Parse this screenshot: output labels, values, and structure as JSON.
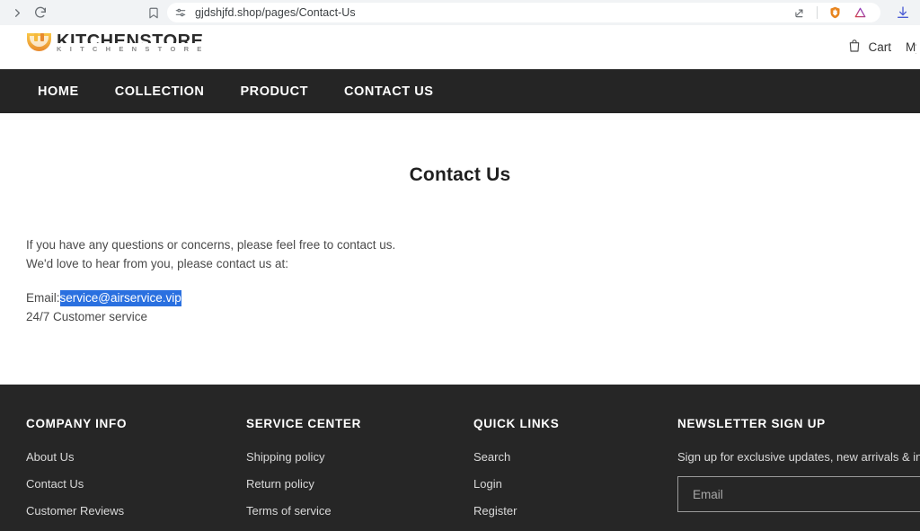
{
  "browser": {
    "url": "gjdshjfd.shop/pages/Contact-Us",
    "forward_icon": "forward-arrow-icon",
    "reload_icon": "reload-icon",
    "bookmark_icon": "bookmark-icon",
    "site_settings_icon": "site-settings-icon",
    "share_icon": "share-icon",
    "shield_icon": "brave-shield-icon",
    "extension_icon": "triangle-extension-icon",
    "download_icon": "download-icon",
    "colors": {
      "chrome_bg": "#f1f3f5",
      "shield": "#e8851f",
      "extension": "#d53f45"
    }
  },
  "header": {
    "logo_wordmark": "KITCHENSTORE",
    "logo_sub": "K I T C H E N S T O R E",
    "cart_label": "Cart",
    "cart_icon": "shopping-bag-icon",
    "account_label": "My Account"
  },
  "nav": {
    "items": [
      {
        "label": "HOME"
      },
      {
        "label": "COLLECTION"
      },
      {
        "label": "PRODUCT"
      },
      {
        "label": "CONTACT US"
      }
    ]
  },
  "main": {
    "title": "Contact Us",
    "paragraph_line1": "If you have any questions or concerns, please feel free to contact us.",
    "paragraph_line2": "We'd love to hear from you, please contact us at:",
    "email_label": "Email:",
    "email_value": "service@airservice.vip",
    "email_selected": true,
    "selection_color": "#2a70e0",
    "support_line": "24/7 Customer service"
  },
  "footer": {
    "bg_color": "#262626",
    "columns": [
      {
        "title": "COMPANY INFO",
        "links": [
          {
            "label": "About Us"
          },
          {
            "label": "Contact Us"
          },
          {
            "label": "Customer Reviews"
          }
        ]
      },
      {
        "title": "SERVICE CENTER",
        "links": [
          {
            "label": "Shipping policy"
          },
          {
            "label": "Return policy"
          },
          {
            "label": "Terms of service"
          }
        ]
      },
      {
        "title": "QUICK LINKS",
        "links": [
          {
            "label": "Search"
          },
          {
            "label": "Login"
          },
          {
            "label": "Register"
          }
        ]
      }
    ],
    "newsletter": {
      "title": "NEWSLETTER SIGN UP",
      "description": "Sign up for exclusive updates, new arrivals & insider only discounts",
      "input_placeholder": "Email",
      "input_value": ""
    }
  }
}
